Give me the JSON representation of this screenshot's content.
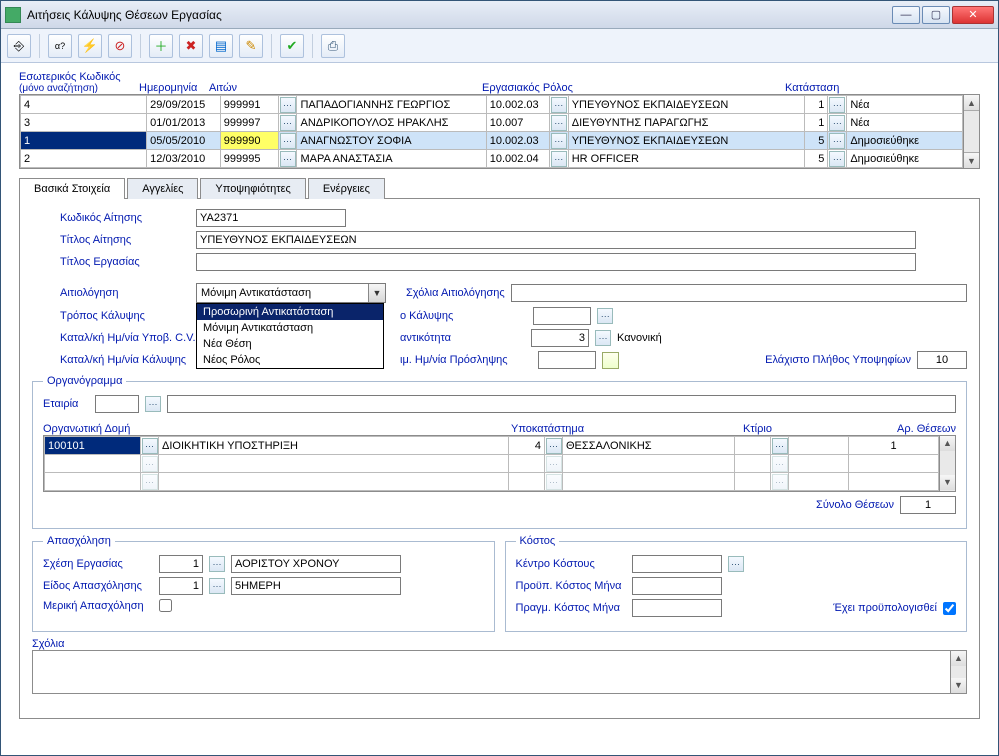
{
  "window": {
    "title": "Αιτήσεις Κάλυψης Θέσεων Εργασίας"
  },
  "toolbar_icons": [
    "door-exit-icon",
    "help-ab-icon",
    "lightning-icon",
    "cancel-circle-icon",
    "add-green-icon",
    "delete-red-icon",
    "filter-blue-icon",
    "pencil-icon",
    "check-green-icon",
    "print-icon"
  ],
  "grid_headers": {
    "code": "Εσωτερικός Κωδικός",
    "code_sub": "(μόνο αναζήτηση)",
    "date": "Ημερομηνία",
    "requester": "Αιτών",
    "role": "Εργασιακός Ρόλος",
    "status": "Κατάσταση"
  },
  "rows": [
    {
      "code": "4",
      "date": "29/09/2015",
      "req": "999991",
      "name": "ΠΑΠΑΔΟΓΙΑΝΝΗΣ ΓΕΩΡΓΙΟΣ",
      "rcode": "10.002.03",
      "role": "ΥΠΕΥΘΥΝΟΣ ΕΚΠΑΙΔΕΥΣΕΩΝ",
      "st": "1",
      "stn": "Νέα"
    },
    {
      "code": "3",
      "date": "01/01/2013",
      "req": "999997",
      "name": "ΑΝΔΡΙΚΟΠΟΥΛΟΣ ΗΡΑΚΛΗΣ",
      "rcode": "10.007",
      "role": "ΔΙΕΥΘΥΝΤΗΣ ΠΑΡΑΓΩΓΗΣ",
      "st": "1",
      "stn": "Νέα"
    },
    {
      "code": "1",
      "date": "05/05/2010",
      "req": "999990",
      "name": "ΑΝΑΓΝΩΣΤΟΥ ΣΟΦΙΑ",
      "rcode": "10.002.03",
      "role": "ΥΠΕΥΘΥΝΟΣ ΕΚΠΑΙΔΕΥΣΕΩΝ",
      "st": "5",
      "stn": "Δημοσιεύθηκε"
    },
    {
      "code": "2",
      "date": "12/03/2010",
      "req": "999995",
      "name": "ΜΑΡΑ ΑΝΑΣΤΑΣΙΑ",
      "rcode": "10.002.04",
      "role": "HR OFFICER",
      "st": "5",
      "stn": "Δημοσιεύθηκε"
    }
  ],
  "tabs": {
    "basic": "Βασικά Στοιχεία",
    "ads": "Αγγελίες",
    "cand": "Υποψηφιότητες",
    "actions": "Ενέργειες"
  },
  "form": {
    "code_lbl": "Κωδικός Αίτησης",
    "code_val": "YA2371",
    "title_lbl": "Τίτλος Αίτησης",
    "title_val": "ΥΠΕΥΘΥΝΟΣ ΕΚΠΑΙΔΕΥΣΕΩΝ",
    "jobtitle_lbl": "Τίτλος Εργασίας",
    "jobtitle_val": "",
    "reason_lbl": "Αιτιολόγηση",
    "reason_sel": "Μόνιμη Αντικατάσταση",
    "reason_opts": [
      "Προσωρινή Αντικατάσταση",
      "Μόνιμη Αντικατάσταση",
      "Νέα Θέση",
      "Νέος Ρόλος"
    ],
    "reason_comments_lbl": "Σχόλια Αιτιολόγησης",
    "cover_lbl": "Τρόπος Κάλυψης",
    "cover_comments_part": "ο Κάλυψης",
    "cv_date_lbl": "Καταλ/κή Ημ/νία Υποβ. C.V.",
    "urgency_part": "αντικότητα",
    "urgency_val": "3",
    "urgency_txt": "Κανονική",
    "cover_date_lbl": "Καταλ/κή Ημ/νία Κάλυψης",
    "hire_date_part": "ιμ. Ημ/νία Πρόσληψης",
    "min_cand_lbl": "Ελάχιστο Πλήθος Υποψηφίων",
    "min_cand_val": "10"
  },
  "org": {
    "legend": "Οργανόγραμμα",
    "company_lbl": "Εταιρία",
    "struct_lbl": "Οργανωτική Δομή",
    "branch_lbl": "Υποκατάστημα",
    "building_lbl": "Κτίριο",
    "positions_lbl": "Αρ. Θέσεων",
    "row": {
      "code": "100101",
      "name": "ΔΙΟΙΚΗΤΙΚΗ ΥΠΟΣΤΗΡΙΞΗ",
      "branch_code": "4",
      "branch": "ΘΕΣΣΑΛΟΝΙΚΗΣ",
      "building": "",
      "positions": "1"
    },
    "total_lbl": "Σύνολο Θέσεων",
    "total_val": "1"
  },
  "emp": {
    "legend": "Απασχόληση",
    "rel_lbl": "Σχέση Εργασίας",
    "rel_code": "1",
    "rel_txt": "ΑΟΡΙΣΤΟΥ ΧΡΟΝΟΥ",
    "type_lbl": "Είδος Απασχόλησης",
    "type_code": "1",
    "type_txt": "5ΗΜΕΡΗ",
    "partial_lbl": "Μερική Απασχόληση"
  },
  "cost": {
    "legend": "Κόστος",
    "center_lbl": "Κέντρο Κόστους",
    "budget_lbl": "Προϋπ. Κόστος Μήνα",
    "actual_lbl": "Πραγμ. Κόστος Μήνα",
    "budgeted_lbl": "Έχει προϋπολογισθεί"
  },
  "comments_lbl": "Σχόλια"
}
